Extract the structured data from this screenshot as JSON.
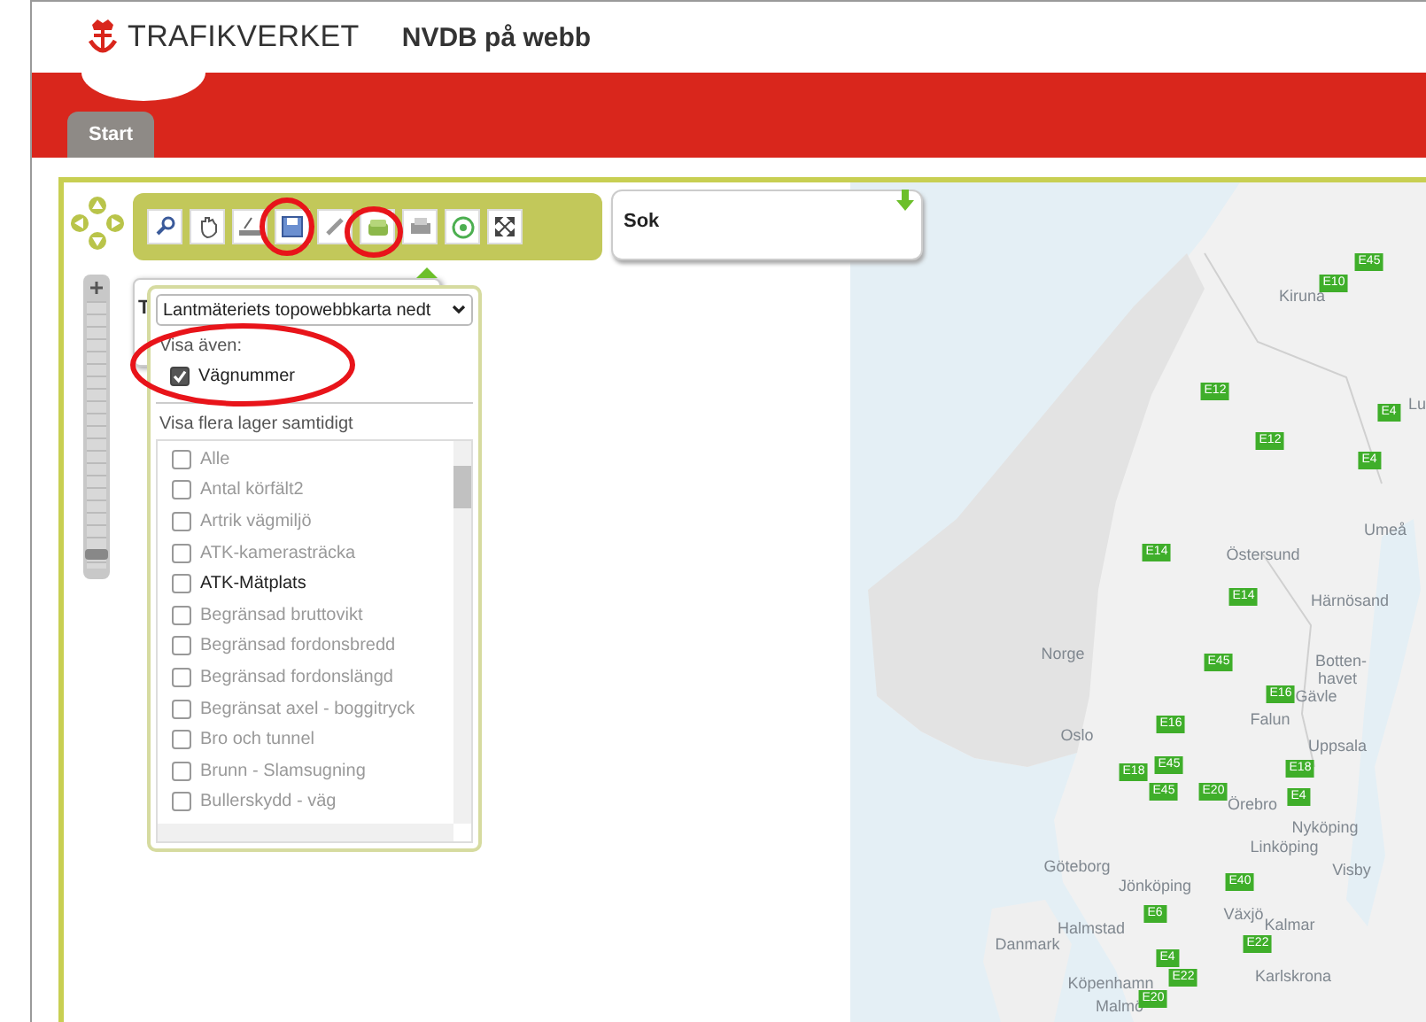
{
  "header": {
    "brand": "TRAFIKVERKET",
    "app_title": "NVDB på webb"
  },
  "tabs": [
    {
      "label": "Start",
      "selected": true
    }
  ],
  "search": {
    "label": "Sok"
  },
  "zoom": {
    "level": 0.05
  },
  "layer_panel": {
    "title_initial": "T",
    "basemap": "Lantmäteriets topowebbkarta nedt",
    "also_show_label": "Visa även:",
    "also_show": [
      {
        "label": "Vägnummer",
        "checked": true
      }
    ],
    "multi_label": "Visa flera lager samtidigt",
    "layers": [
      {
        "label": "Alle",
        "checked": false,
        "available": false
      },
      {
        "label": "Antal körfält2",
        "checked": false,
        "available": false
      },
      {
        "label": "Artrik vägmiljö",
        "checked": false,
        "available": false
      },
      {
        "label": "ATK-kamerasträcka",
        "checked": false,
        "available": false
      },
      {
        "label": "ATK-Mätplats",
        "checked": false,
        "available": true
      },
      {
        "label": "Begränsad bruttovikt",
        "checked": false,
        "available": false
      },
      {
        "label": "Begränsad fordonsbredd",
        "checked": false,
        "available": false
      },
      {
        "label": "Begränsad fordonslängd",
        "checked": false,
        "available": false
      },
      {
        "label": "Begränsat axel - boggitryck",
        "checked": false,
        "available": false
      },
      {
        "label": "Bro och tunnel",
        "checked": false,
        "available": false
      },
      {
        "label": "Brunn - Slamsugning",
        "checked": false,
        "available": false
      },
      {
        "label": "Bullerskydd - väg",
        "checked": false,
        "available": false
      }
    ]
  },
  "map": {
    "places": [
      "Kiruna",
      "Lu",
      "Umeå",
      "Östersund",
      "Härnösand",
      "Norge",
      "Botten-",
      "havet",
      "Gävle",
      "Falun",
      "Oslo",
      "Uppsala",
      "Örebro",
      "Nyköping",
      "Linköping",
      "Visby",
      "Göteborg",
      "Jönköping",
      "Halmstad",
      "Växjö",
      "Kalmar",
      "Danmark",
      "Karlskrona",
      "Köpenhamn",
      "Malmö"
    ],
    "road_numbers": [
      "E45",
      "E10",
      "E12",
      "E12",
      "E4",
      "E4",
      "E14",
      "E14",
      "E45",
      "E16",
      "E16",
      "E18",
      "E45",
      "E18",
      "E45",
      "E20",
      "E4",
      "E40",
      "E6",
      "E22",
      "E4",
      "E22",
      "E20"
    ]
  }
}
